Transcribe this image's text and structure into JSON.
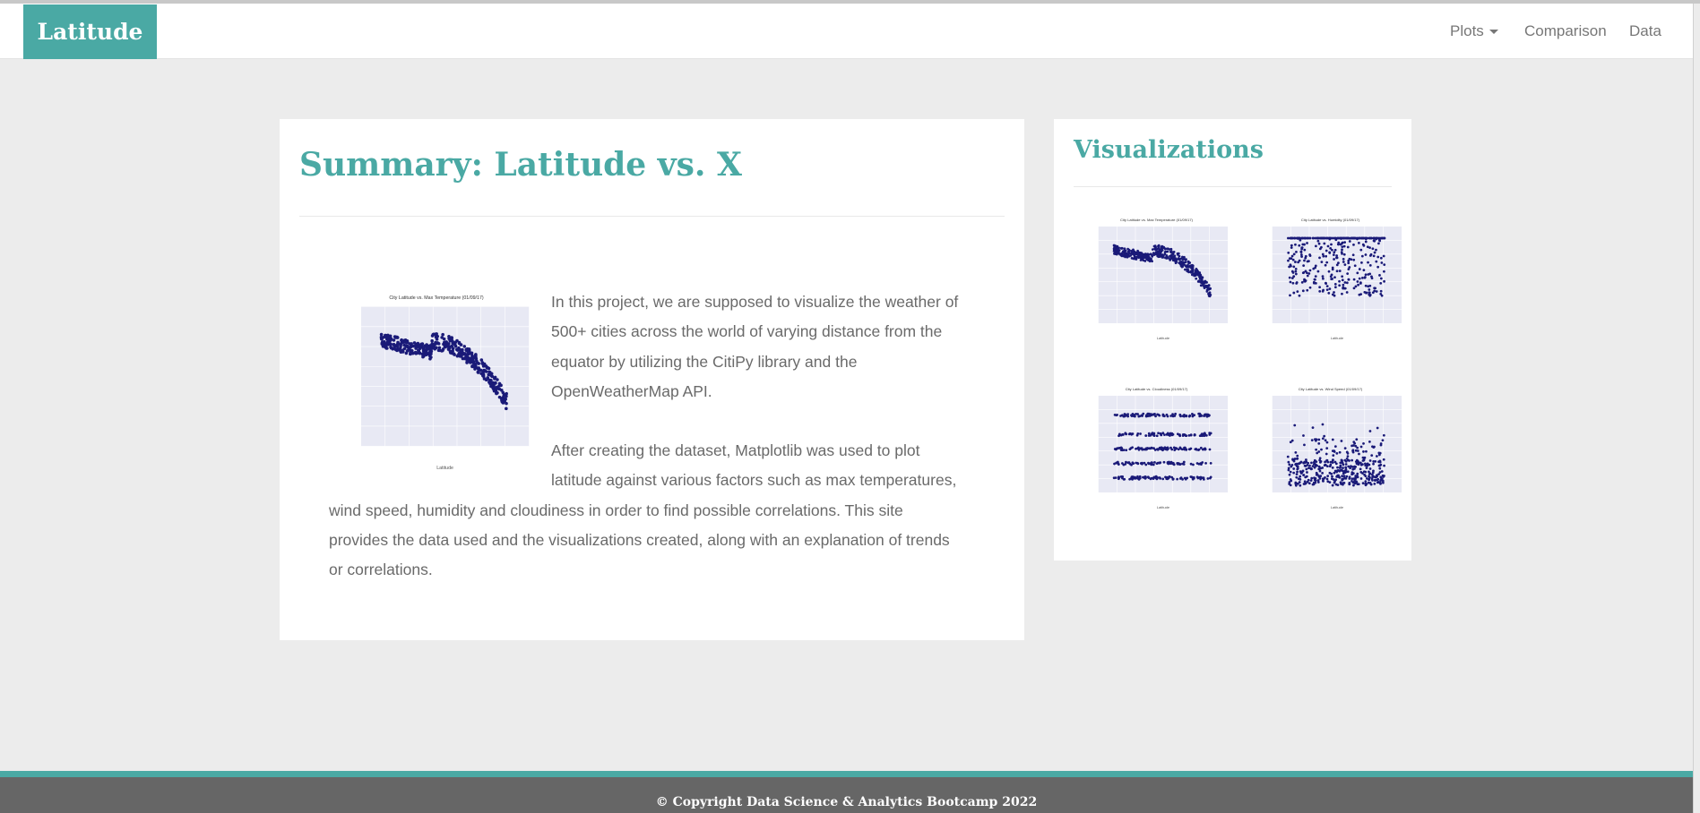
{
  "brand": "Latitude",
  "nav": {
    "plots_label": "Plots",
    "comparison_label": "Comparison",
    "data_label": "Data"
  },
  "summary": {
    "title": "Summary: Latitude vs. X",
    "paragraph_1": "In this project, we are supposed to visualize the weather of 500+ cities across the world of varying distance from the equator by utilizing the CitiPy library and the OpenWeatherMap API.",
    "paragraph_2": "After creating the dataset, Matplotlib was used to plot latitude against various factors such as max temperatures, wind speed, humidity and cloudiness in order to find possible correlations. This site provides the data used and the visualizations created, along with an explanation of trends or correlations."
  },
  "visualizations": {
    "title": "Visualizations",
    "thumbnails": [
      {
        "caption": "City Latitude vs. Max Temperature (01/09/17)",
        "pattern": "temperature"
      },
      {
        "caption": "City Latitude vs. Humidity (01/09/17)",
        "pattern": "humidity"
      },
      {
        "caption": "City Latitude vs. Cloudiness (01/09/17)",
        "pattern": "cloudiness"
      },
      {
        "caption": "City Latitude vs. Wind Speed (01/09/17)",
        "pattern": "wind"
      }
    ]
  },
  "featured_figure": {
    "caption": "City Latitude vs. Max Temperature (01/09/17)",
    "xlabel": "Latitude",
    "pattern": "temperature"
  },
  "footer": {
    "text": "© Copyright Data Science & Analytics Bootcamp 2022"
  },
  "colors": {
    "accent": "#4aa9a4",
    "footer": "#666666",
    "plot_bg": "#e8e9f4",
    "points": "#1a1a78"
  }
}
